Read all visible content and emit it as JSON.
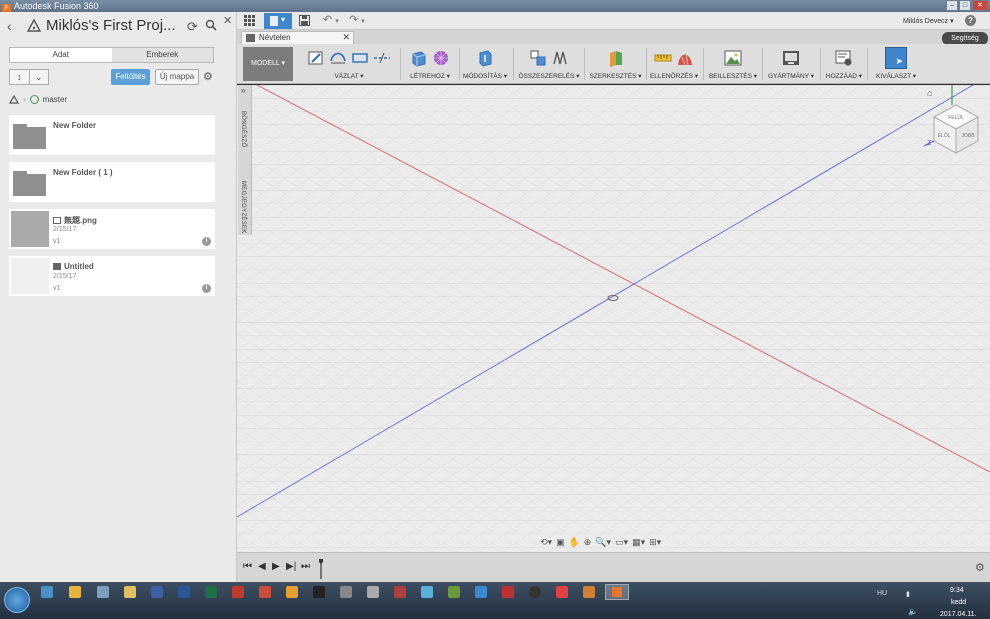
{
  "window": {
    "title": "Autodesk Fusion 360"
  },
  "data_panel": {
    "project_title": "Miklós's First Proj...",
    "tabs": [
      {
        "label": "Adat"
      },
      {
        "label": "Emberek"
      }
    ],
    "upload_label": "Feltöltés",
    "new_folder_label": "Új mappa",
    "branch_label": "master",
    "items": [
      {
        "name": "New Folder",
        "type": "folder"
      },
      {
        "name": "New Folder ( 1 )",
        "type": "folder"
      },
      {
        "name": "無題.png",
        "date": "2/15/17",
        "version": "v1",
        "type": "image"
      },
      {
        "name": "Untitled",
        "date": "2/15/17",
        "version": "v1",
        "type": "design"
      }
    ]
  },
  "app_toolbar": {
    "user_name": "Miklós Devecz",
    "help_label": "?"
  },
  "document_tab": {
    "label": "Névtelen"
  },
  "help_button": {
    "label": "Segítség"
  },
  "ribbon": {
    "workspace_label": "MODELL",
    "groups": [
      {
        "label": "VÁZLAT"
      },
      {
        "label": "LÉTREHOZ"
      },
      {
        "label": "MÓDOSÍTÁS"
      },
      {
        "label": "ÖSSZESZERELÉS"
      },
      {
        "label": "SZERKESZTÉS"
      },
      {
        "label": "ELLENŐRZÉS"
      },
      {
        "label": "BEILLESZTÉS"
      },
      {
        "label": "GYÁRTMÁNY"
      },
      {
        "label": "HOZZÁAD"
      },
      {
        "label": "KIVÁLASZT"
      }
    ]
  },
  "side_panels": {
    "browser_label": "BÖNGÉSZŐ",
    "comments_label": "MEGJEGYZÉSEK"
  },
  "viewcube": {
    "top_label": "FELÜL",
    "front_label": "ELÖL",
    "right_label": "JOBB",
    "axis_z": "Z"
  },
  "taskbar": {
    "language": "HU",
    "time": "9:34",
    "day": "kedd",
    "date": "2017.04.11."
  },
  "colors": {
    "accent": "#3f86cc",
    "x_axis": "#e05a5a",
    "y_axis": "#5a6ee0",
    "upload": "#5c9fd8"
  }
}
